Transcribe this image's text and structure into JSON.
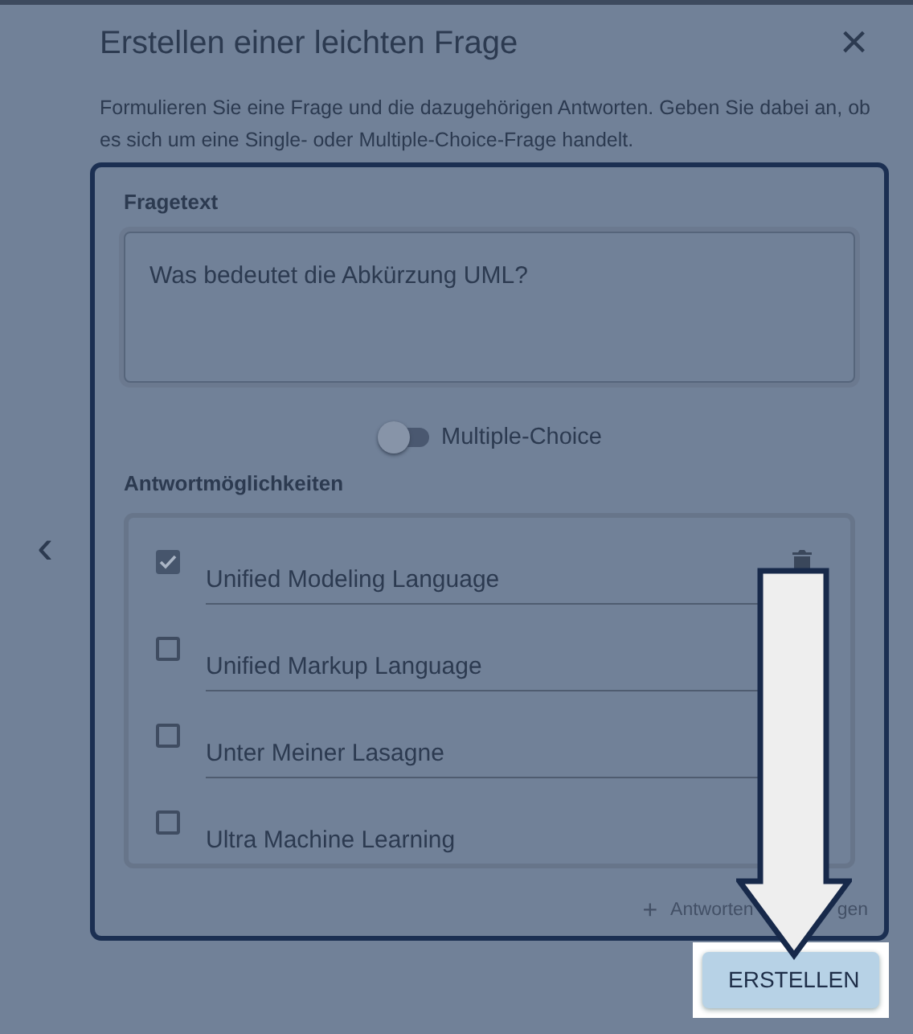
{
  "dialog": {
    "title": "Erstellen einer leichten Frage",
    "close": "×",
    "description": "Formulieren Sie eine Frage und die dazugehörigen Antworten. Geben Sie dabei an, ob es sich um eine Single- oder Multiple-Choice-Frage handelt."
  },
  "carousel_prev": "‹",
  "question": {
    "label": "Fragetext",
    "value": "Was bedeutet die Abkürzung UML?"
  },
  "toggle": {
    "label": "Multiple-Choice",
    "on": false
  },
  "answers_label": "Antwortmöglichkeiten",
  "answers": [
    {
      "text": "Unified Modeling Language",
      "checked": true
    },
    {
      "text": "Unified Markup Language",
      "checked": false
    },
    {
      "text": "Unter Meiner Lasagne",
      "checked": false
    },
    {
      "text": "Ultra Machine Learning",
      "checked": false
    }
  ],
  "add_answer": {
    "icon": "+",
    "label_start": "Antworten",
    "label_end": "gen"
  },
  "submit": {
    "label": "ERSTELLEN",
    "highlighted": true
  }
}
